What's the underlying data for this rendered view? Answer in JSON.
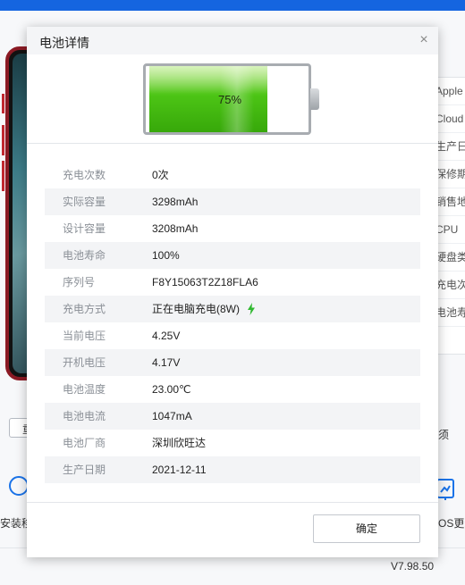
{
  "dialog": {
    "title": "电池详情",
    "close_icon": "close-icon",
    "ok_label": "确定"
  },
  "battery": {
    "level_percent": 75,
    "label": "75%",
    "fill_color": "#4cc415"
  },
  "details": [
    {
      "label": "充电次数",
      "value": "0次"
    },
    {
      "label": "实际容量",
      "value": "3298mAh"
    },
    {
      "label": "设计容量",
      "value": "3208mAh"
    },
    {
      "label": "电池寿命",
      "value": "100%"
    },
    {
      "label": "序列号",
      "value": "F8Y15063T2Z18FLA6"
    },
    {
      "label": "充电方式",
      "value": "正在电脑充电(8W)"
    },
    {
      "label": "当前电压",
      "value": "4.25V"
    },
    {
      "label": "开机电压",
      "value": "4.17V"
    },
    {
      "label": "电池温度",
      "value": "23.00℃"
    },
    {
      "label": "电池电流",
      "value": "1047mA"
    },
    {
      "label": "电池厂商",
      "value": "深圳欣旺达"
    },
    {
      "label": "生产日期",
      "value": "2021-12-11"
    }
  ],
  "background": {
    "right_list": [
      "Apple",
      "Cloud",
      "生产日",
      "保修期",
      "销售地",
      "CPU",
      "硬盘类",
      "充电次",
      "电池寿",
      ""
    ],
    "left_button_fragment": "重",
    "right_text_fragment": "须",
    "left_tool_label": "安装移",
    "right_tool_label": "OS更新",
    "version": "V7.98.50",
    "accent_color": "#1565e0",
    "phone_color": "#8b1a24"
  }
}
